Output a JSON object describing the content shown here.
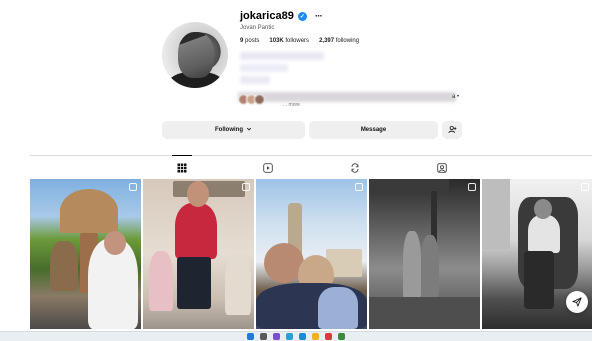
{
  "profile": {
    "username": "jokarica89",
    "verified_icon": "verified-badge-icon",
    "full_name": "Jovan Pantic",
    "stats": {
      "posts_count": "9",
      "posts_label": "posts",
      "followers_count": "103K",
      "followers_label": "followers",
      "following_count": "2,397",
      "following_label": "following"
    },
    "followed_by_tail": "a •",
    "more_link": "... more"
  },
  "actions": {
    "following_label": "Following",
    "message_label": "Message",
    "suggest_icon": "add-person-icon"
  },
  "tabs": [
    {
      "name": "posts",
      "icon": "grid-icon",
      "active": true
    },
    {
      "name": "reels",
      "icon": "reels-icon",
      "active": false
    },
    {
      "name": "reposts",
      "icon": "repost-icon",
      "active": false
    },
    {
      "name": "tagged",
      "icon": "tagged-icon",
      "active": false
    }
  ],
  "posts": [
    {
      "type": "carousel"
    },
    {
      "type": "carousel"
    },
    {
      "type": "carousel"
    },
    {
      "type": "carousel"
    },
    {
      "type": "carousel"
    }
  ],
  "colors": {
    "verified": "#1a8cf0",
    "button_bg": "#efefef",
    "divider": "#dbdbdb"
  }
}
